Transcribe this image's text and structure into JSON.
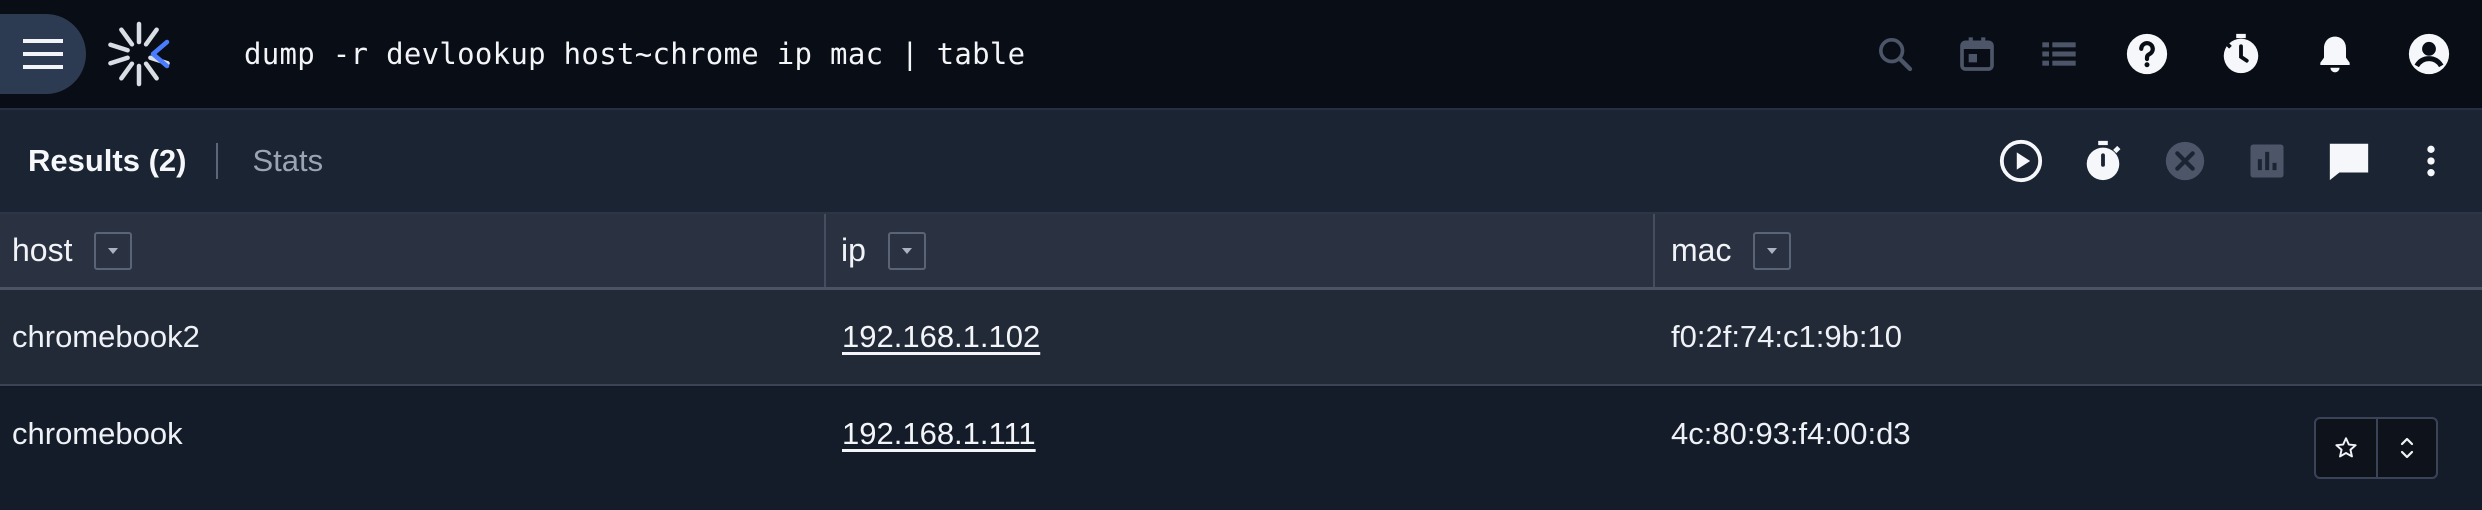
{
  "topbar": {
    "query": "dump -r devlookup host~chrome ip mac | table",
    "icons": [
      "menu-icon",
      "logo-icon",
      "search-icon",
      "calendar-icon",
      "list-icon",
      "help-icon",
      "timer-history-icon",
      "bell-icon",
      "account-icon"
    ]
  },
  "toolbar": {
    "results_label": "Results (2)",
    "stats_label": "Stats",
    "icons": [
      "play-circle-icon",
      "stopwatch-icon",
      "cancel-icon",
      "bar-chart-icon",
      "comment-icon",
      "more-vert-icon"
    ]
  },
  "table": {
    "columns": [
      "host",
      "ip",
      "mac"
    ],
    "rows": [
      {
        "host": "chromebook2",
        "ip": "192.168.1.102",
        "mac": "f0:2f:74:c1:9b:10"
      },
      {
        "host": "chromebook",
        "ip": "192.168.1.111",
        "mac": "4c:80:93:f4:00:d3"
      }
    ]
  },
  "row_actions": [
    "star-icon",
    "expand-icon"
  ],
  "colors": {
    "background": "#131a27",
    "topbar": "#090d15",
    "accent": "#4a7cff"
  }
}
